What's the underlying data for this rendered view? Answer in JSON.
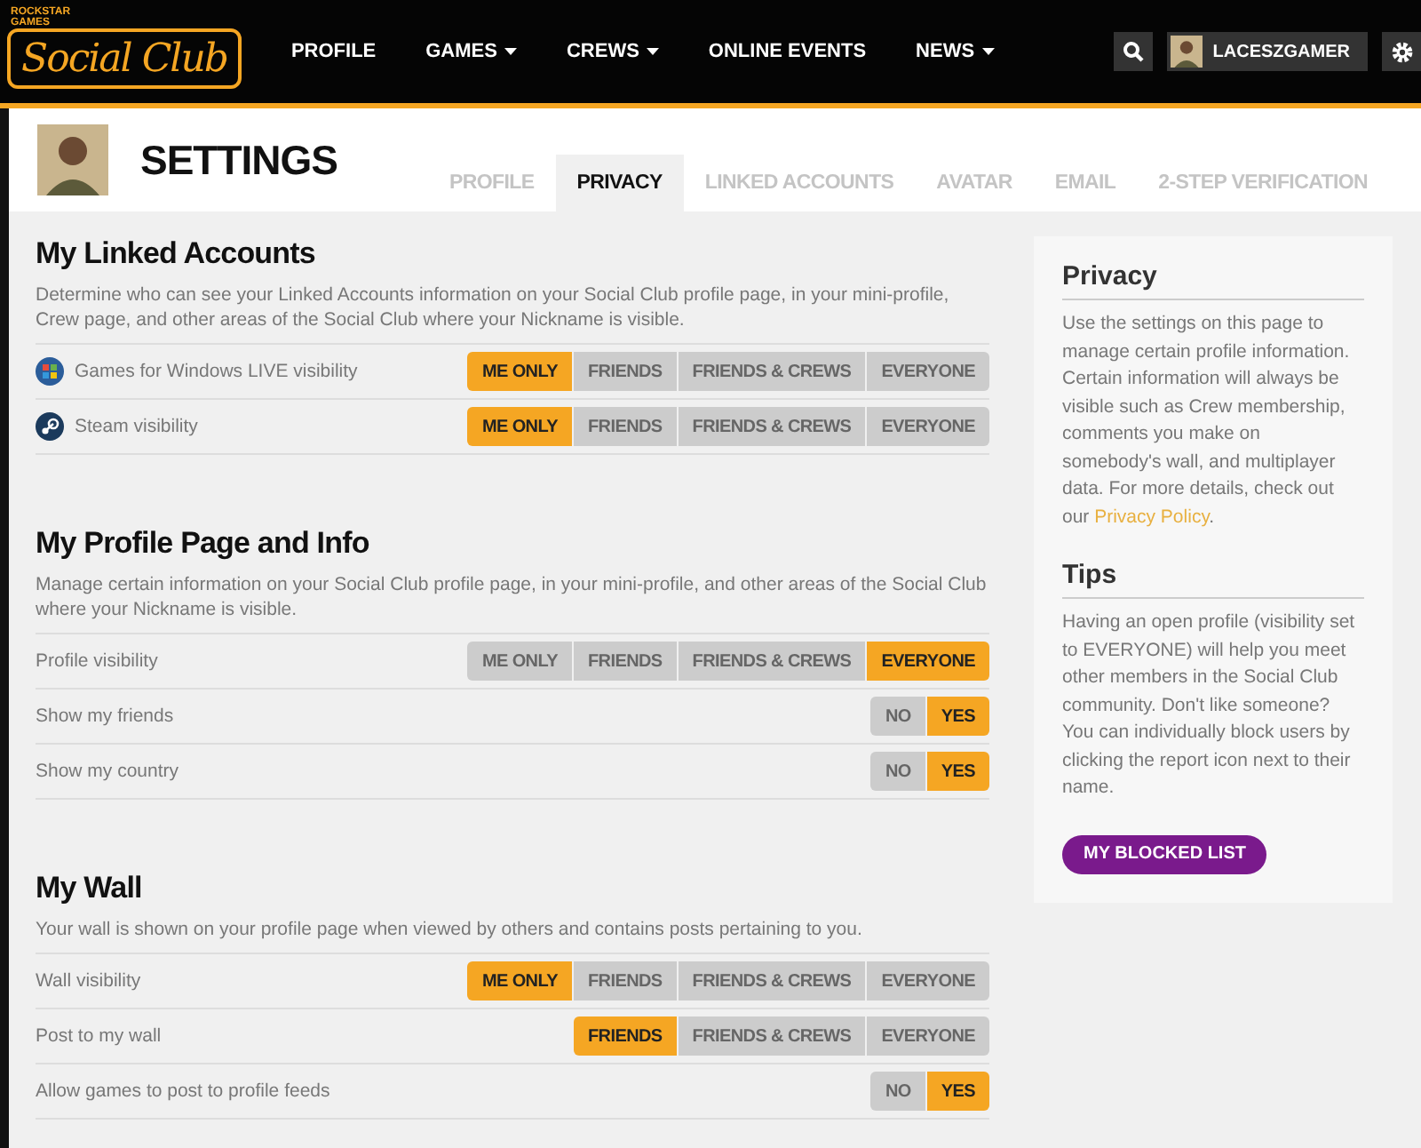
{
  "nav": {
    "logo_small": "ROCKSTAR GAMES",
    "logo": "Social Club",
    "items": [
      {
        "label": "PROFILE",
        "dropdown": false
      },
      {
        "label": "GAMES",
        "dropdown": true
      },
      {
        "label": "CREWS",
        "dropdown": true
      },
      {
        "label": "ONLINE EVENTS",
        "dropdown": false
      },
      {
        "label": "NEWS",
        "dropdown": true
      }
    ],
    "username": "LACESZGAMER"
  },
  "header": {
    "title": "SETTINGS",
    "tabs": [
      {
        "label": "PROFILE",
        "selected": false
      },
      {
        "label": "PRIVACY",
        "selected": true
      },
      {
        "label": "LINKED ACCOUNTS",
        "selected": false
      },
      {
        "label": "AVATAR",
        "selected": false
      },
      {
        "label": "EMAIL",
        "selected": false
      },
      {
        "label": "2-STEP VERIFICATION",
        "selected": false
      }
    ]
  },
  "sections": [
    {
      "title": "My Linked Accounts",
      "description": "Determine who can see your Linked Accounts information on your Social Club profile page, in your mini-profile, Crew page, and other areas of the Social Club where your Nickname is visible.",
      "rows": [
        {
          "label": "Games for Windows LIVE visibility",
          "kind": "windows",
          "options": [
            {
              "label": "ME ONLY",
              "selected": true
            },
            {
              "label": "FRIENDS",
              "selected": false
            },
            {
              "label": "FRIENDS & CREWS",
              "selected": false
            },
            {
              "label": "EVERYONE",
              "selected": false
            }
          ]
        },
        {
          "label": "Steam visibility",
          "kind": "steam",
          "options": [
            {
              "label": "ME ONLY",
              "selected": true
            },
            {
              "label": "FRIENDS",
              "selected": false
            },
            {
              "label": "FRIENDS & CREWS",
              "selected": false
            },
            {
              "label": "EVERYONE",
              "selected": false
            }
          ]
        }
      ]
    },
    {
      "title": "My Profile Page and Info",
      "description": "Manage certain information on your Social Club profile page, in your mini-profile, and other areas of the Social Club where your Nickname is visible.",
      "rows": [
        {
          "label": "Profile visibility",
          "options": [
            {
              "label": "ME ONLY",
              "selected": false
            },
            {
              "label": "FRIENDS",
              "selected": false
            },
            {
              "label": "FRIENDS & CREWS",
              "selected": false
            },
            {
              "label": "EVERYONE",
              "selected": true
            }
          ]
        },
        {
          "label": "Show my friends",
          "options": [
            {
              "label": "NO",
              "selected": false
            },
            {
              "label": "YES",
              "selected": true
            }
          ]
        },
        {
          "label": "Show my country",
          "options": [
            {
              "label": "NO",
              "selected": false
            },
            {
              "label": "YES",
              "selected": true
            }
          ]
        }
      ]
    },
    {
      "title": "My Wall",
      "description": "Your wall is shown on your profile page when viewed by others and contains posts pertaining to you.",
      "rows": [
        {
          "label": "Wall visibility",
          "options": [
            {
              "label": "ME ONLY",
              "selected": true
            },
            {
              "label": "FRIENDS",
              "selected": false
            },
            {
              "label": "FRIENDS & CREWS",
              "selected": false
            },
            {
              "label": "EVERYONE",
              "selected": false
            }
          ]
        },
        {
          "label": "Post to my wall",
          "options": [
            {
              "label": "FRIENDS",
              "selected": true
            },
            {
              "label": "FRIENDS & CREWS",
              "selected": false
            },
            {
              "label": "EVERYONE",
              "selected": false
            }
          ]
        },
        {
          "label": "Allow games to post to profile feeds",
          "options": [
            {
              "label": "NO",
              "selected": false
            },
            {
              "label": "YES",
              "selected": true
            }
          ]
        }
      ]
    }
  ],
  "sidebar": {
    "privacy_title": "Privacy",
    "privacy_text": "Use the settings on this page to manage certain profile information. Certain information will always be visible such as Crew membership, comments you make on somebody's wall, and multiplayer data. For more details, check out our ",
    "privacy_link": "Privacy Policy",
    "privacy_end": ".",
    "tips_title": "Tips",
    "tips_text": "Having an open profile (visibility set to EVERYONE) will help you meet other members in the Social Club community. Don't like someone? You can individually block users by clicking the report icon next to their name.",
    "button": "MY BLOCKED LIST"
  }
}
